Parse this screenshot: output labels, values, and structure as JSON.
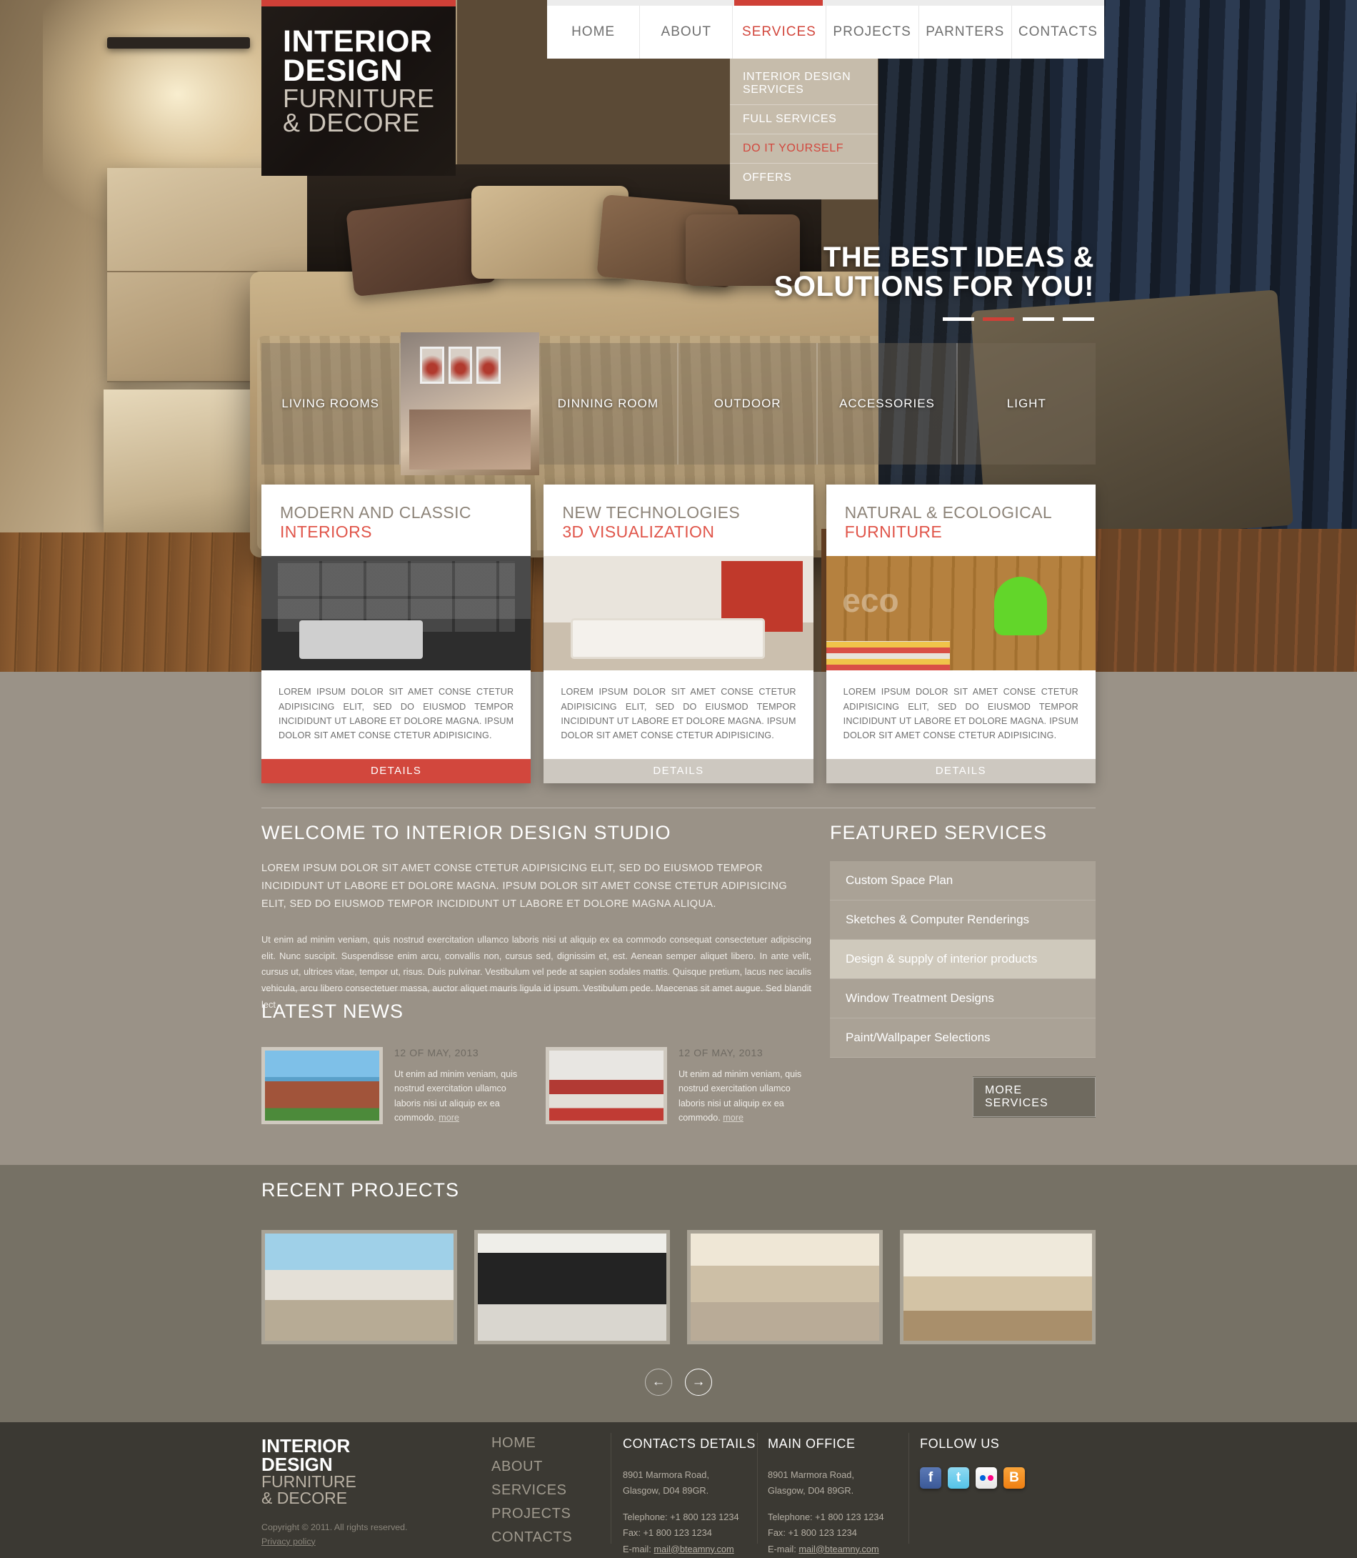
{
  "brand": {
    "line1": "INTERIOR",
    "line2": "DESIGN",
    "line3": "FURNITURE",
    "line4": "& DECORE"
  },
  "nav": {
    "items": [
      {
        "label": "HOME",
        "active": false
      },
      {
        "label": "ABOUT",
        "active": false
      },
      {
        "label": "SERVICES",
        "active": true
      },
      {
        "label": "PROJECTS",
        "active": false
      },
      {
        "label": "PARNTERS",
        "active": false
      },
      {
        "label": "CONTACTS",
        "active": false
      }
    ],
    "dropdown": [
      {
        "label": "INTERIOR DESIGN SERVICES",
        "active": false
      },
      {
        "label": "FULL SERVICES",
        "active": false
      },
      {
        "label": "DO IT YOURSELF",
        "active": true
      },
      {
        "label": "OFFERS",
        "active": false
      }
    ]
  },
  "hero": {
    "tagline_line1": "THE BEST IDEAS &",
    "tagline_line2": "SOLUTIONS FOR YOU!",
    "slider_dots": 4,
    "slider_active_index": 1
  },
  "categories": [
    {
      "label": "LIVING ROOMS",
      "type": "text"
    },
    {
      "label": "",
      "type": "photo"
    },
    {
      "label": "DINNING ROOM",
      "type": "text"
    },
    {
      "label": "OUTDOOR",
      "type": "text"
    },
    {
      "label": "ACCESSORIES",
      "type": "text"
    },
    {
      "label": "LIGHT",
      "type": "text"
    }
  ],
  "cards": [
    {
      "title_top": "MODERN AND CLASSIC",
      "title_bottom": "INTERIORS",
      "body": "LOREM IPSUM DOLOR SIT AMET CONSE CTETUR ADIPISICING ELIT, SED DO EIUSMOD TEMPOR INCIDIDUNT UT LABORE ET DOLORE MAGNA. IPSUM DOLOR SIT AMET CONSE CTETUR ADIPISICING.",
      "button": "DETAILS",
      "button_style": "red"
    },
    {
      "title_top": "NEW TECHNOLOGIES",
      "title_bottom": "3D VISUALIZATION",
      "body": "LOREM IPSUM DOLOR SIT AMET CONSE CTETUR ADIPISICING ELIT, SED DO EIUSMOD TEMPOR INCIDIDUNT UT LABORE ET DOLORE MAGNA. IPSUM DOLOR SIT AMET CONSE CTETUR ADIPISICING.",
      "button": "DETAILS",
      "button_style": "grey"
    },
    {
      "title_top": "NATURAL & ECOLOGICAL",
      "title_bottom": "FURNITURE",
      "body": "LOREM IPSUM DOLOR SIT AMET CONSE CTETUR ADIPISICING ELIT, SED DO EIUSMOD TEMPOR INCIDIDUNT UT LABORE ET DOLORE MAGNA. IPSUM DOLOR SIT AMET CONSE CTETUR ADIPISICING.",
      "button": "DETAILS",
      "button_style": "grey"
    }
  ],
  "welcome": {
    "heading": "WELCOME TO INTERIOR DESIGN STUDIO",
    "lead": "LOREM IPSUM DOLOR SIT AMET CONSE CTETUR ADIPISICING ELIT, SED DO EIUSMOD TEMPOR INCIDIDUNT UT LABORE ET DOLORE MAGNA. IPSUM DOLOR SIT AMET CONSE CTETUR ADIPISICING ELIT, SED DO EIUSMOD TEMPOR INCIDIDUNT UT LABORE ET DOLORE MAGNA ALIQUA.",
    "body": "Ut enim ad minim veniam, quis nostrud exercitation ullamco laboris nisi ut aliquip ex ea commodo consequat consectetuer adipiscing elit. Nunc suscipit. Suspendisse enim arcu, convallis non, cursus sed, dignissim et, est. Aenean semper aliquet libero. In ante velit, cursus ut, ultrices vitae, tempor ut, risus. Duis pulvinar. Vestibulum vel pede at sapien sodales mattis. Quisque pretium, lacus nec iaculis vehicula, arcu libero consectetuer massa, auctor aliquet mauris ligula id ipsum. Vestibulum pede. Maecenas sit amet augue. Sed blandit lect"
  },
  "news": {
    "heading": "LATEST NEWS",
    "items": [
      {
        "date": "12 OF MAY, 2013",
        "text": "Ut enim ad minim veniam, quis nostrud exercitation ullamco laboris nisi ut aliquip ex ea commodo.",
        "more": "more"
      },
      {
        "date": "12 OF MAY, 2013",
        "text": "Ut enim ad minim veniam, quis nostrud exercitation ullamco laboris nisi ut aliquip ex ea commodo.",
        "more": "more"
      }
    ]
  },
  "featured": {
    "heading": "FEATURED SERVICES",
    "items": [
      {
        "label": "Custom Space Plan",
        "active": false
      },
      {
        "label": "Sketches & Computer Renderings",
        "active": false
      },
      {
        "label": "Design & supply of interior products",
        "active": true
      },
      {
        "label": "Window Treatment Designs",
        "active": false
      },
      {
        "label": "Paint/Wallpaper Selections",
        "active": false
      }
    ],
    "more_button": "MORE SERVICES"
  },
  "projects": {
    "heading": "RECENT PROJECTS",
    "count": 4,
    "prev_icon": "←",
    "next_icon": "→"
  },
  "footer": {
    "brand": {
      "line1": "INTERIOR",
      "line2": "DESIGN",
      "line3": "FURNITURE",
      "line4": "& DECORE"
    },
    "copyright": "Copyright © 2011. All rights reserved.",
    "privacy": "Privacy policy",
    "nav": [
      "HOME",
      "ABOUT",
      "SERVICES",
      "PROJECTS",
      "CONTACTS"
    ],
    "contacts": {
      "heading": "CONTACTS DETAILS",
      "address1": "8901 Marmora Road,",
      "address2": "Glasgow, D04 89GR.",
      "telephone": "Telephone: +1 800 123 1234",
      "fax": "Fax: +1 800 123 1234",
      "email_label": "E-mail:",
      "email": "mail@bteamny.com"
    },
    "office": {
      "heading": "MAIN OFFICE",
      "address1": "8901 Marmora Road,",
      "address2": "Glasgow, D04 89GR.",
      "telephone": "Telephone: +1 800 123 1234",
      "fax": "Fax: +1 800 123 1234",
      "email_label": "E-mail:",
      "email": "mail@bteamny.com"
    },
    "follow": {
      "heading": "FOLLOW US",
      "socials": [
        {
          "name": "facebook-icon",
          "glyph": "f"
        },
        {
          "name": "twitter-icon",
          "glyph": "t"
        },
        {
          "name": "flickr-icon",
          "glyph": ""
        },
        {
          "name": "blogger-icon",
          "glyph": "B"
        }
      ]
    }
  },
  "colors": {
    "accent_red": "#d2473d",
    "page_bg": "#9a9287",
    "band_bg": "#767165",
    "footer_bg": "#3b3933"
  }
}
